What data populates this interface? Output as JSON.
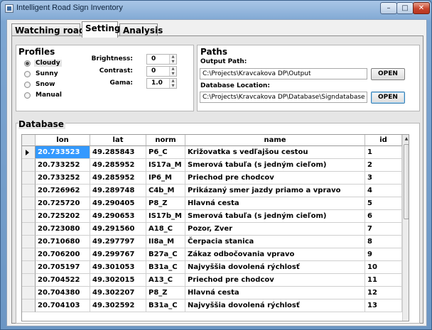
{
  "window": {
    "title": "Intelligent Road Sign Inventory",
    "minimize": "–",
    "maximize": "□",
    "close": "✕"
  },
  "tabs": [
    {
      "label": "Watching road",
      "active": false
    },
    {
      "label": "Setting",
      "active": true
    },
    {
      "label": "Analysis",
      "active": false
    }
  ],
  "profiles": {
    "title": "Profiles",
    "options": [
      "Cloudy",
      "Sunny",
      "Snow",
      "Manual"
    ],
    "selected": "Cloudy",
    "brightness": {
      "label": "Brightness:",
      "value": "0"
    },
    "contrast": {
      "label": "Contrast:",
      "value": "0"
    },
    "gama": {
      "label": "Gama:",
      "value": "1.0"
    }
  },
  "paths": {
    "title": "Paths",
    "output_label": "Output Path:",
    "output_value": "C:\\Projects\\Kravcakova DP\\Output",
    "database_label": "Database Location:",
    "database_value": "C:\\Projects\\Kravcakova DP\\Database\\Signdatabase",
    "open_label": "OPEN"
  },
  "database": {
    "title": "Database",
    "columns": [
      "lon",
      "lat",
      "norm",
      "name",
      "id"
    ],
    "rows": [
      [
        "20.733523",
        "49.285843",
        "P6_C",
        "Križovatka s vedľajšou cestou",
        "1"
      ],
      [
        "20.733252",
        "49.285952",
        "IS17a_M",
        "Smerová tabuľa (s jedným cieľom)",
        "2"
      ],
      [
        "20.733252",
        "49.285952",
        "IP6_M",
        "Priechod pre chodcov",
        "3"
      ],
      [
        "20.726962",
        "49.289748",
        "C4b_M",
        "Prikázaný smer jazdy priamo a vpravo",
        "4"
      ],
      [
        "20.725720",
        "49.290405",
        "P8_Z",
        "Hlavná cesta",
        "5"
      ],
      [
        "20.725202",
        "49.290653",
        "IS17b_M",
        "Smerová tabuľa (s jedným cieľom)",
        "6"
      ],
      [
        "20.723080",
        "49.291560",
        "A18_C",
        "Pozor, Zver",
        "7"
      ],
      [
        "20.710680",
        "49.297797",
        "II8a_M",
        "Čerpacia stanica",
        "8"
      ],
      [
        "20.706200",
        "49.299767",
        "B27a_C",
        "Zákaz odbočovania vpravo",
        "9"
      ],
      [
        "20.705197",
        "49.301053",
        "B31a_C",
        "Najvyššia dovolená rýchlosť",
        "10"
      ],
      [
        "20.704522",
        "49.302015",
        "A13_C",
        "Priechod pre chodcov",
        "11"
      ],
      [
        "20.704380",
        "49.302207",
        "P8_Z",
        "Hlavná cesta",
        "12"
      ],
      [
        "20.704103",
        "49.302592",
        "B31a_C",
        "Najvyššia dovolená rýchlosť",
        "13"
      ]
    ],
    "selected_row": 0
  },
  "colors": {
    "selection": "#3399ff",
    "title_bar": "#a9c6e6"
  }
}
